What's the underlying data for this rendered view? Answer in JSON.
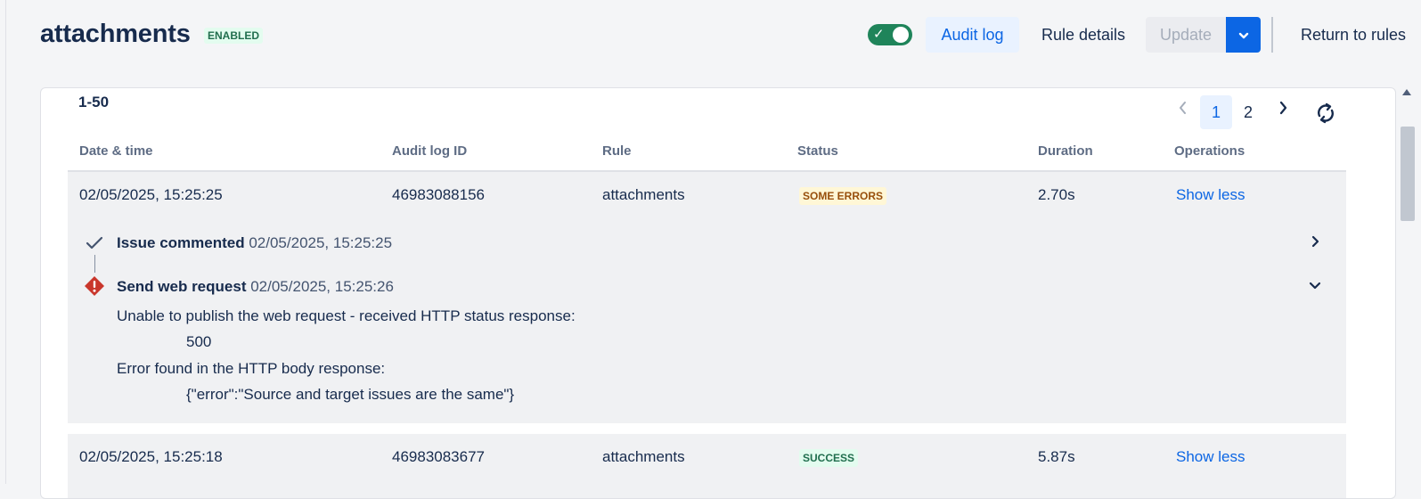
{
  "header": {
    "title": "attachments",
    "status_badge": "ENABLED",
    "toggle_on": true,
    "audit_log_label": "Audit log",
    "rule_details_label": "Rule details",
    "update_label": "Update",
    "return_label": "Return to rules"
  },
  "panel": {
    "range_label": "1-50",
    "pagination": {
      "pages": [
        "1",
        "2"
      ],
      "current": "1"
    },
    "columns": [
      "Date & time",
      "Audit log ID",
      "Rule",
      "Status",
      "Duration",
      "Operations"
    ],
    "rows": [
      {
        "datetime": "02/05/2025, 15:25:25",
        "audit_id": "46983088156",
        "rule": "attachments",
        "status": "SOME ERRORS",
        "duration": "2.70s",
        "operation": "Show less",
        "details": [
          {
            "title": "Issue commented",
            "time": "02/05/2025, 15:25:25",
            "state": "success"
          },
          {
            "title": "Send web request",
            "time": "02/05/2025, 15:25:26",
            "state": "error",
            "messages": {
              "line1": "Unable to publish the web request - received HTTP status response:",
              "line1_value": "500",
              "line2": "Error found in the HTTP body response:",
              "line2_value": "{\"error\":\"Source and target issues are the same\"}"
            }
          }
        ]
      },
      {
        "datetime": "02/05/2025, 15:25:18",
        "audit_id": "46983083677",
        "rule": "attachments",
        "status": "SUCCESS",
        "duration": "5.87s",
        "operation": "Show less"
      }
    ]
  },
  "colors": {
    "primary": "#0c66e4",
    "success_bg": "#e3fcef",
    "success_text": "#216e4e",
    "warning_bg": "#fff7d6",
    "warning_text": "#974f0c",
    "error": "#c9372c",
    "toggle_on": "#1f845a"
  },
  "icons": {
    "toggle_check": "check-icon",
    "pager_prev": "chevron-left-icon",
    "pager_next": "chevron-right-icon",
    "refresh": "refresh-icon",
    "success": "check-icon",
    "error": "error-diamond-icon",
    "expand": "chevron-right-icon",
    "collapse": "chevron-down-icon",
    "dropdown": "chevron-down-icon"
  }
}
